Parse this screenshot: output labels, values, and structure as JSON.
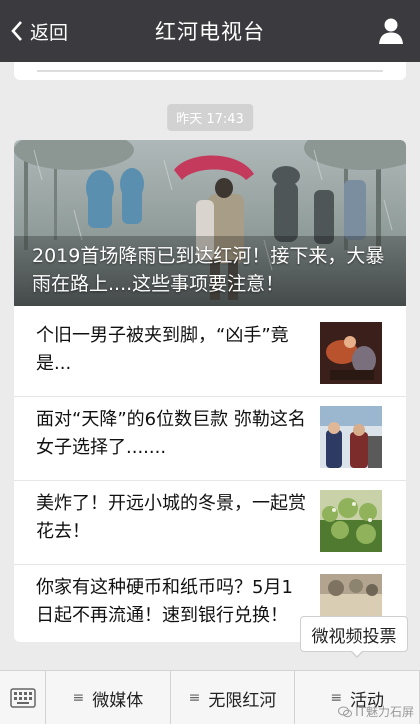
{
  "nav": {
    "back_label": "返回",
    "title": "红河电视台"
  },
  "timestamp": "昨天 17:43",
  "article": {
    "hero_title": "2019首场降雨已到达红河！接下来，大暴雨在路上....这些事项要注意！",
    "items": [
      {
        "title": "个旧一男子被夹到脚，“凶手”竟是..."
      },
      {
        "title": "面对“天降”的6位数巨款 弥勒这名女子选择了......."
      },
      {
        "title": "美炸了！开远小城的冬景，一起赏花去！"
      },
      {
        "title": "你家有这种硬币和纸币吗？5月1日起不再流通！速到银行兑换！"
      }
    ]
  },
  "popup": {
    "label": "微视频投票"
  },
  "bottom_menu": {
    "items": [
      {
        "label": "微媒体"
      },
      {
        "label": "无限红河"
      },
      {
        "label": "活动"
      }
    ]
  },
  "watermark": "IT魅力石屏"
}
